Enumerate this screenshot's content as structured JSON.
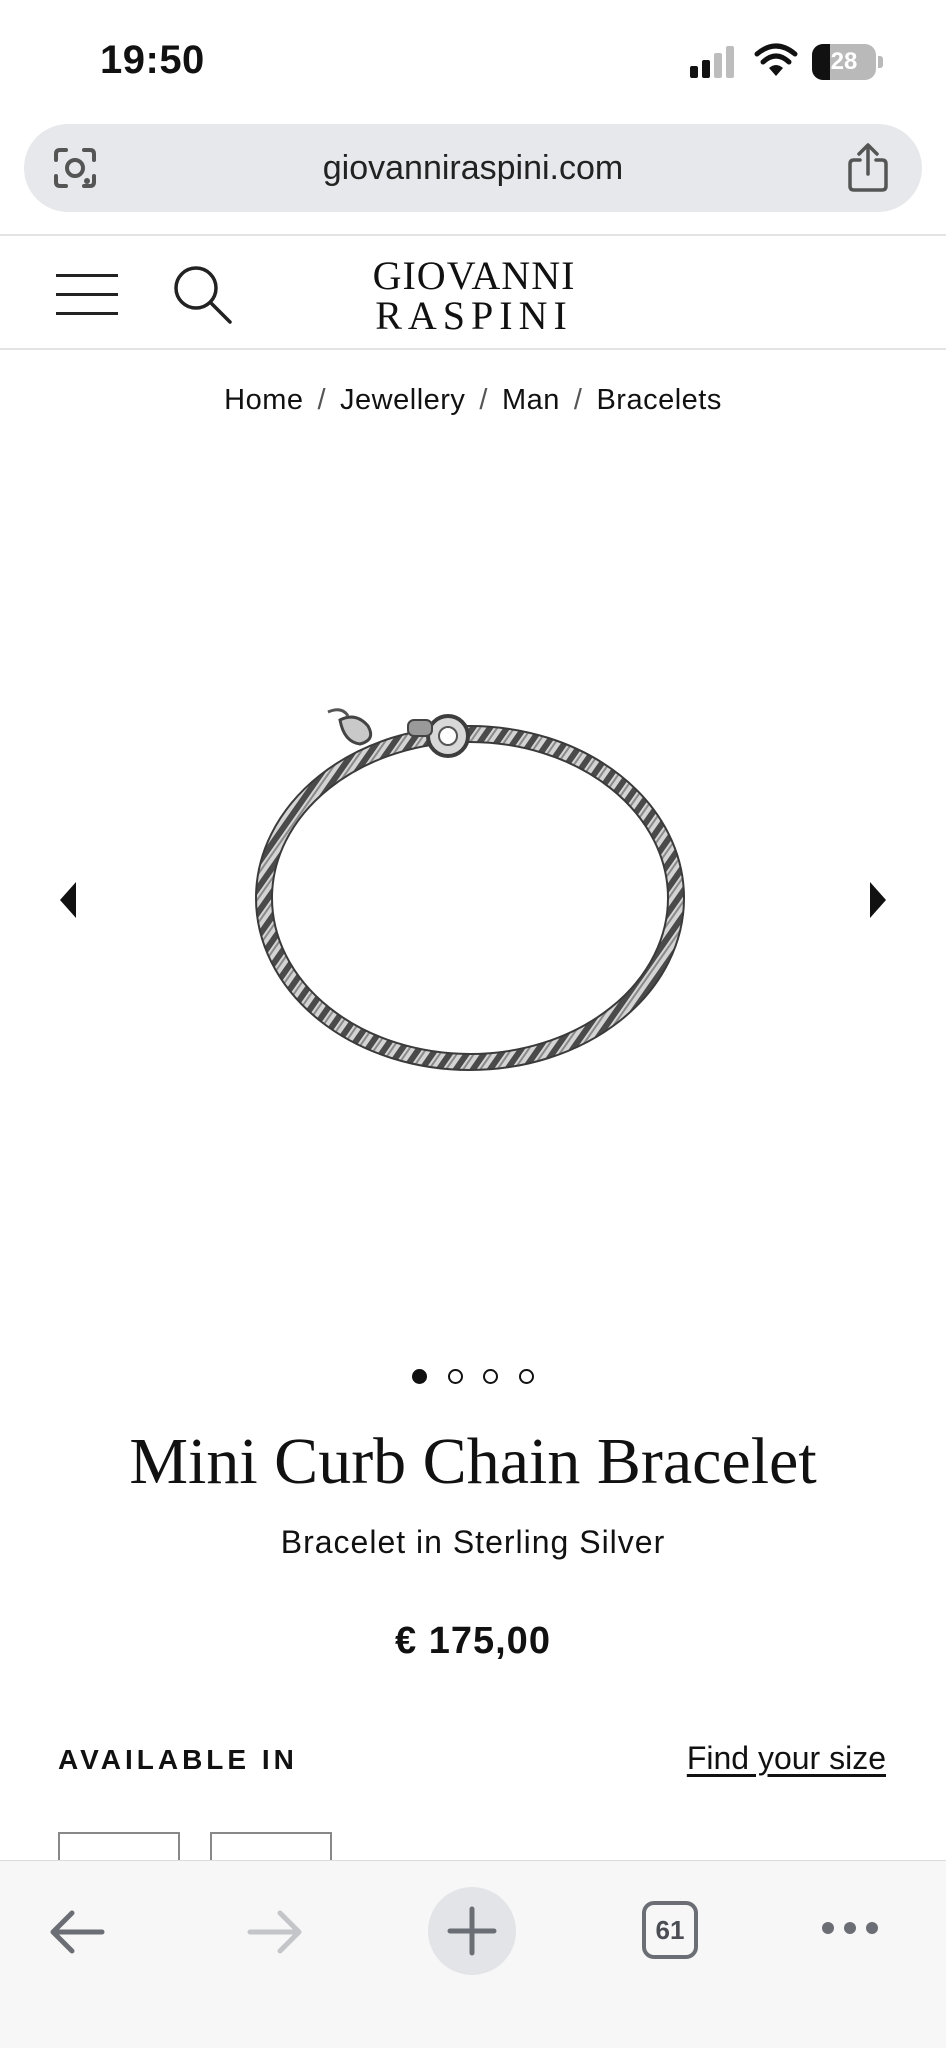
{
  "status_bar": {
    "time": "19:50",
    "battery_level": "28",
    "battery_fraction": 0.28,
    "signal_icon": "cellular-signal-icon",
    "wifi_icon": "wifi-icon"
  },
  "browser": {
    "url": "giovanniraspini.com",
    "tabs_count": "61",
    "icons": [
      "camera-search-icon",
      "share-icon",
      "back-arrow-icon",
      "forward-arrow-icon",
      "plus-icon",
      "more-icon"
    ]
  },
  "header": {
    "logo_line1": "GIOVANNI",
    "logo_line2": "RASPINI",
    "icons": [
      "hamburger-menu-icon",
      "search-icon"
    ]
  },
  "breadcrumb": {
    "items": [
      "Home",
      "Jewellery",
      "Man",
      "Bracelets"
    ]
  },
  "gallery": {
    "slide_count": 4,
    "active_slide": 1
  },
  "product": {
    "title": "Mini Curb Chain Bracelet",
    "subtitle": "Bracelet in Sterling Silver",
    "price": "€ 175,00",
    "available_label": "AVAILABLE IN",
    "find_size_label": "Find your size"
  },
  "colors": {
    "text": "#111111",
    "url_bar_bg": "#e6e8eb",
    "toolbar_bg": "#f7f7f8",
    "silver": "#b8b8b8",
    "silver_dark": "#4a4a4a"
  }
}
